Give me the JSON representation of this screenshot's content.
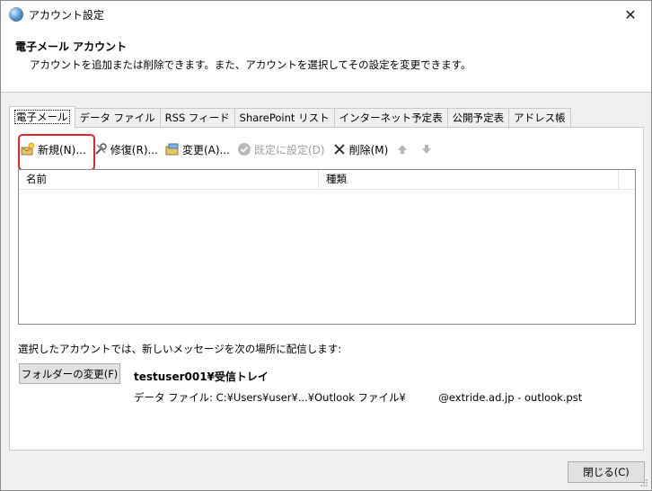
{
  "window": {
    "title": "アカウント設定",
    "close_glyph": "✕"
  },
  "header": {
    "title": "電子メール アカウント",
    "description": "アカウントを追加または削除できます。また、アカウントを選択してその設定を変更できます。"
  },
  "tabs": [
    {
      "label": "電子メール",
      "active": true
    },
    {
      "label": "データ ファイル"
    },
    {
      "label": "RSS フィード"
    },
    {
      "label": "SharePoint リスト"
    },
    {
      "label": "インターネット予定表"
    },
    {
      "label": "公開予定表"
    },
    {
      "label": "アドレス帳"
    }
  ],
  "toolbar": {
    "new_label": "新規(N)...",
    "repair_label": "修復(R)...",
    "change_label": "変更(A)...",
    "set_default_label": "既定に設定(D)",
    "delete_label": "削除(M)",
    "highlight_color": "#e0252b"
  },
  "list": {
    "columns": [
      "名前",
      "種類"
    ]
  },
  "delivery": {
    "text": "選択したアカウントでは、新しいメッセージを次の場所に配信します:",
    "folder_button": "フォルダーの変更(F)",
    "inbox_path": "testuser001¥受信トレイ",
    "datafile_path": "データ ファイル: C:¥Users¥user¥...¥Outlook ファイル¥          @extride.ad.jp - outlook.pst"
  },
  "footer": {
    "close_button": "閉じる(C)"
  }
}
